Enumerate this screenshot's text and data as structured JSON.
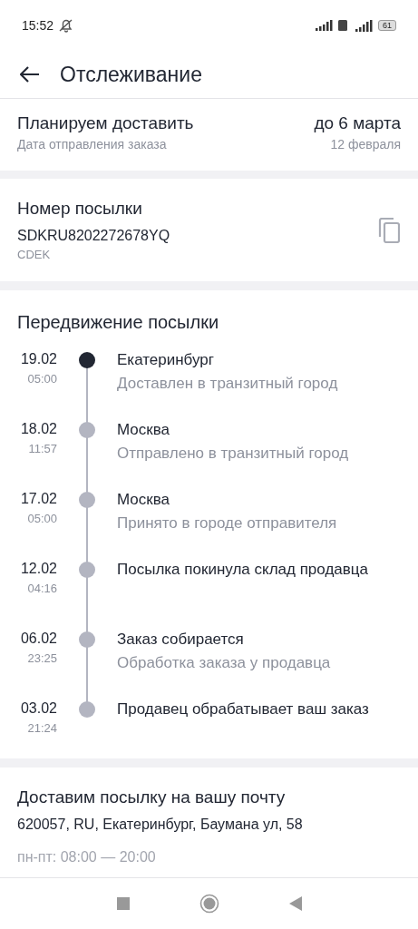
{
  "status_bar": {
    "time": "15:52",
    "battery": "61"
  },
  "header": {
    "title": "Отслеживание"
  },
  "delivery": {
    "label": "Планируем доставить",
    "date": "до 6 марта",
    "sub_label": "Дата отправления заказа",
    "sub_date": "12 февраля"
  },
  "parcel": {
    "title": "Номер посылки",
    "number": "SDKRU8202272678YQ",
    "carrier": "CDEK"
  },
  "movement": {
    "title": "Передвижение посылки",
    "events": [
      {
        "date": "19.02",
        "time": "05:00",
        "title": "Екатеринбург",
        "subtitle": "Доставлен в транзитный город",
        "current": true
      },
      {
        "date": "18.02",
        "time": "11:57",
        "title": "Москва",
        "subtitle": "Отправлено в транзитный город",
        "current": false
      },
      {
        "date": "17.02",
        "time": "05:00",
        "title": "Москва",
        "subtitle": "Принято в городе отправителя",
        "current": false
      },
      {
        "date": "12.02",
        "time": "04:16",
        "title": "Посылка покинула склад продавца",
        "current": false
      },
      {
        "date": "06.02",
        "time": "23:25",
        "title": "Заказ собирается",
        "subtitle": "Обработка заказа у продавца",
        "current": false
      },
      {
        "date": "03.02",
        "time": "21:24",
        "title": "Продавец обрабатывает ваш заказ",
        "current": false
      }
    ]
  },
  "post_office": {
    "title": "Доставим посылку на вашу почту",
    "address": "620057, RU, Екатеринбург, Баумана ул, 58",
    "hours": "пн-пт: 08:00 — 20:00"
  }
}
